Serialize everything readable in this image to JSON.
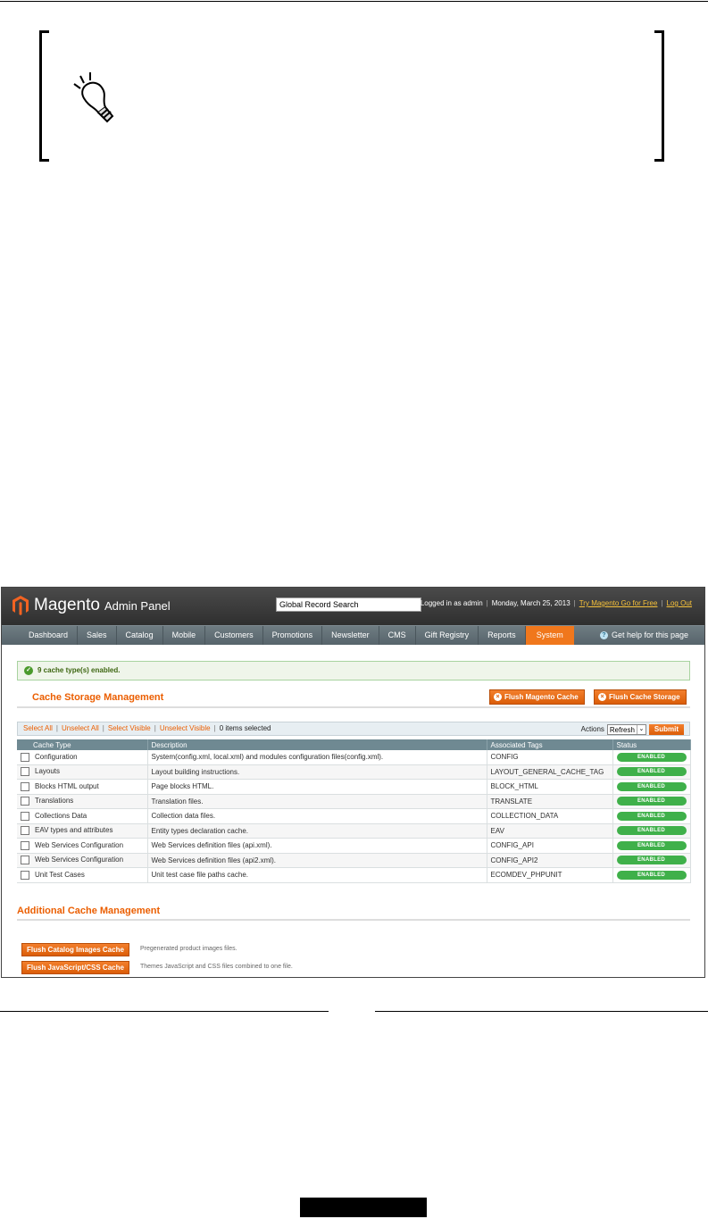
{
  "header": {
    "logo_word": "Magento",
    "logo_sub": "Admin Panel",
    "search_value": "Global Record Search",
    "logged_in": "Logged in as admin",
    "date": "Monday, March 25, 2013",
    "try_link": "Try Magento Go for Free",
    "logout_link": "Log Out"
  },
  "nav": {
    "items": [
      "Dashboard",
      "Sales",
      "Catalog",
      "Mobile",
      "Customers",
      "Promotions",
      "Newsletter",
      "CMS",
      "Gift Registry",
      "Reports",
      "System"
    ],
    "active": "System",
    "help": "Get help for this page"
  },
  "notice": "9 cache type(s) enabled.",
  "cache_title": "Cache Storage Management",
  "buttons": {
    "flush_magento": "Flush Magento Cache",
    "flush_storage": "Flush Cache Storage"
  },
  "massaction": {
    "select_all": "Select All",
    "unselect_all": "Unselect All",
    "select_visible": "Select Visible",
    "unselect_visible": "Unselect Visible",
    "selected": "0 items selected",
    "actions_label": "Actions",
    "action_value": "Refresh",
    "submit": "Submit"
  },
  "table": {
    "headers": [
      "Cache Type",
      "Description",
      "Associated Tags",
      "Status"
    ],
    "rows": [
      {
        "type": "Configuration",
        "desc": "System(config.xml, local.xml) and modules configuration files(config.xml).",
        "tag": "CONFIG",
        "status": "ENABLED"
      },
      {
        "type": "Layouts",
        "desc": "Layout building instructions.",
        "tag": "LAYOUT_GENERAL_CACHE_TAG",
        "status": "ENABLED"
      },
      {
        "type": "Blocks HTML output",
        "desc": "Page blocks HTML.",
        "tag": "BLOCK_HTML",
        "status": "ENABLED"
      },
      {
        "type": "Translations",
        "desc": "Translation files.",
        "tag": "TRANSLATE",
        "status": "ENABLED"
      },
      {
        "type": "Collections Data",
        "desc": "Collection data files.",
        "tag": "COLLECTION_DATA",
        "status": "ENABLED"
      },
      {
        "type": "EAV types and attributes",
        "desc": "Entity types declaration cache.",
        "tag": "EAV",
        "status": "ENABLED"
      },
      {
        "type": "Web Services Configuration",
        "desc": "Web Services definition files (api.xml).",
        "tag": "CONFIG_API",
        "status": "ENABLED"
      },
      {
        "type": "Web Services Configuration",
        "desc": "Web Services definition files (api2.xml).",
        "tag": "CONFIG_API2",
        "status": "ENABLED"
      },
      {
        "type": "Unit Test Cases",
        "desc": "Unit test case file paths cache.",
        "tag": "ECOMDEV_PHPUNIT",
        "status": "ENABLED"
      }
    ]
  },
  "additional": {
    "title": "Additional Cache Management",
    "catalog_button": "Flush Catalog Images Cache",
    "catalog_desc": "Pregenerated product images files.",
    "js_button": "Flush JavaScript/CSS Cache",
    "js_desc": "Themes JavaScript and CSS files combined to one file."
  }
}
